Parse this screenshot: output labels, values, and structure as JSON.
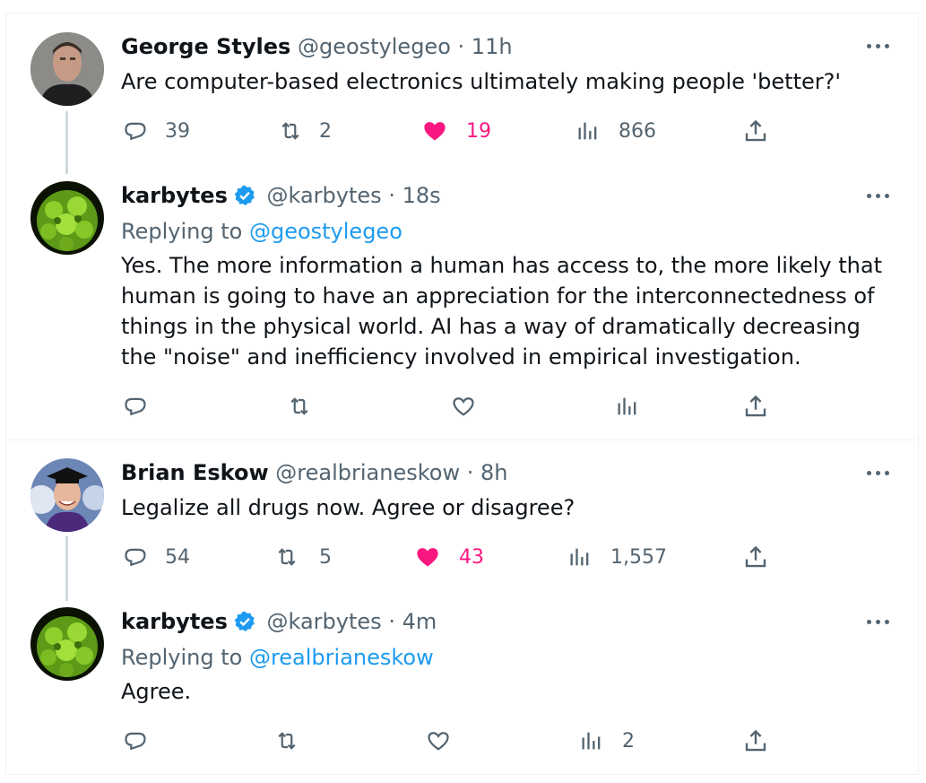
{
  "tweets": [
    {
      "name": "George Styles",
      "handle": "@geostylegeo",
      "time": "11h",
      "verified": false,
      "text": "Are computer-based electronics ultimately making people 'better?'",
      "replies": "39",
      "retweets": "2",
      "likes": "19",
      "views": "866",
      "liked": true
    },
    {
      "name": "karbytes",
      "handle": "@karbytes",
      "time": "18s",
      "verified": true,
      "replying_label": "Replying to",
      "replying_to": "@geostylegeo",
      "text": "Yes. The more information a human has access to, the more likely that human is going to have an appreciation for the interconnectedness of things in the physical world. AI has a way of dramatically decreasing the \"noise\" and inefficiency involved in empirical investigation.",
      "replies": "",
      "retweets": "",
      "likes": "",
      "views": "",
      "liked": false
    },
    {
      "name": "Brian Eskow",
      "handle": "@realbrianeskow",
      "time": "8h",
      "verified": false,
      "text": "Legalize all drugs now. Agree or disagree?",
      "replies": "54",
      "retweets": "5",
      "likes": "43",
      "views": "1,557",
      "liked": true
    },
    {
      "name": "karbytes",
      "handle": "@karbytes",
      "time": "4m",
      "verified": true,
      "replying_label": "Replying to",
      "replying_to": "@realbrianeskow",
      "text": "Agree.",
      "replies": "",
      "retweets": "",
      "likes": "",
      "views": "2",
      "liked": false
    }
  ],
  "separator": "·",
  "colors": {
    "like": "#f91880",
    "link": "#1d9bf0",
    "muted": "#536471",
    "verified": "#1d9bf0"
  },
  "icons": [
    "reply-icon",
    "retweet-icon",
    "heart-icon",
    "views-icon",
    "share-icon",
    "more-icon",
    "verified-badge-icon"
  ]
}
